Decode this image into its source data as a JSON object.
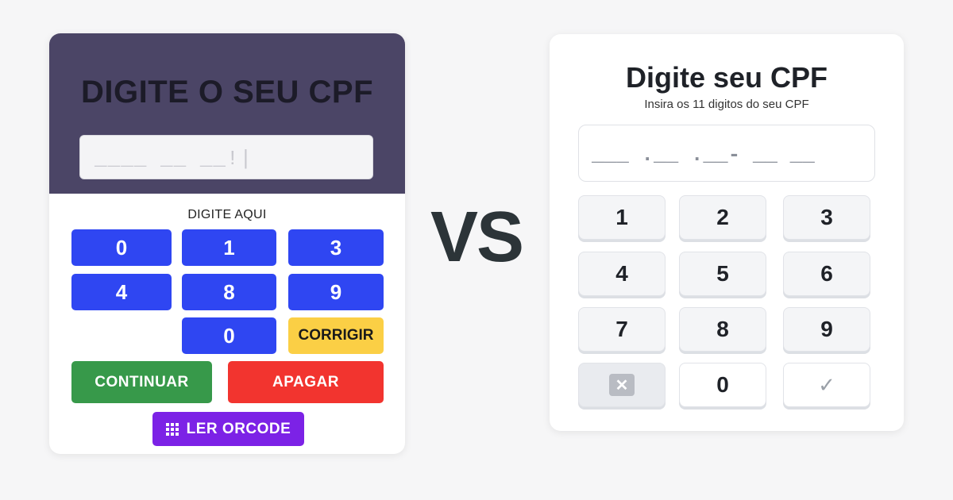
{
  "left": {
    "title": "DIGITE O SEU CPF",
    "input_value": "____ __ __!|",
    "caption": "DIGITE AQUI",
    "keys": [
      "0",
      "1",
      "3",
      "4",
      "8",
      "9",
      "0"
    ],
    "corrigir_label": "CORRIGIR",
    "continuar_label": "CONTINUAR",
    "apagar_label": "APAGAR",
    "qr_label": "LER ORCODE",
    "colors": {
      "header": "#4b4566",
      "blue": "#2f46f2",
      "yellow": "#fbcf45",
      "green": "#37994a",
      "red": "#f2342f",
      "purple": "#7c22e6"
    }
  },
  "vs_label": "VS",
  "right": {
    "title": "Digite seu CPF",
    "subtitle": "Insira os 11 digitos do seu CPF",
    "input_value": "___ .__ .__- __ __",
    "keys": [
      "1",
      "2",
      "3",
      "4",
      "5",
      "6",
      "7",
      "8",
      "9",
      "0"
    ],
    "delete_icon": "backspace-x-icon",
    "confirm_icon": "check-icon"
  }
}
